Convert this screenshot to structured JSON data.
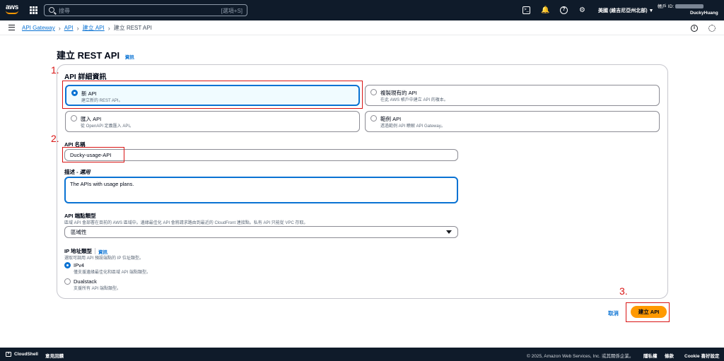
{
  "topnav": {
    "logo": "aws",
    "search_placeholder": "搜尋",
    "search_shortcut": "[選項+S]",
    "region": "美國 (維吉尼亞州北部) ▼",
    "account_label": "帳戶 ID:",
    "username": "DuckyHuang"
  },
  "breadcrumb": {
    "items": [
      "API Gateway",
      "API",
      "建立 API"
    ],
    "current": "建立 REST API"
  },
  "page": {
    "title": "建立 REST API",
    "title_info": "資訊"
  },
  "annotations": {
    "step1": "1.",
    "step2": "2.",
    "step3": "3."
  },
  "details": {
    "section_title": "API 詳細資訊",
    "options": [
      {
        "label": "新 API",
        "desc": "建立新的 REST API。",
        "selected": true
      },
      {
        "label": "複製現有的 API",
        "desc": "在此 AWS 帳戶中建立 API 的複本。",
        "selected": false
      },
      {
        "label": "匯入 API",
        "desc": "從 OpenAPI 定義匯入 API。",
        "selected": false
      },
      {
        "label": "範例 API",
        "desc": "透過範例 API 瞭解 API Gateway。",
        "selected": false
      }
    ]
  },
  "api_name": {
    "label": "API 名稱",
    "value": "Ducky-usage-API"
  },
  "description": {
    "label": "描述 - ",
    "label_optional": "選用",
    "value": "The APIs with usage plans."
  },
  "endpoint": {
    "label": "API 端點類型",
    "desc": "區域 API 會部署在目前的 AWS 區域中。邊緣最佳化 API 會將請求路由到最近的 CloudFront 連接點。私有 API 只能從 VPC 存取。",
    "selected": "區域性"
  },
  "ip_type": {
    "label": "IP 地址類型",
    "info": "資訊",
    "desc": "選取可調用 API 預設端點的 IP 位址類型。",
    "options": [
      {
        "label": "IPv4",
        "desc": "僅支援邊緣最佳化和區域 API 端點類型。",
        "selected": true
      },
      {
        "label": "Dualstack",
        "desc": "支援所有 API 端點類型。",
        "selected": false
      }
    ]
  },
  "actions": {
    "cancel": "取消",
    "create": "建立 API"
  },
  "footer": {
    "cloudshell": "CloudShell",
    "feedback": "意見回饋",
    "copyright": "© 2025, Amazon Web Services, Inc. 或其關係企業。",
    "privacy": "隱私權",
    "terms": "條款",
    "cookie": "Cookie 喜好設定"
  },
  "colors": {
    "nav_bg": "#0f1b2a",
    "accent": "#0972d3",
    "primary_button": "#ff9900",
    "annotation": "#d91515"
  }
}
